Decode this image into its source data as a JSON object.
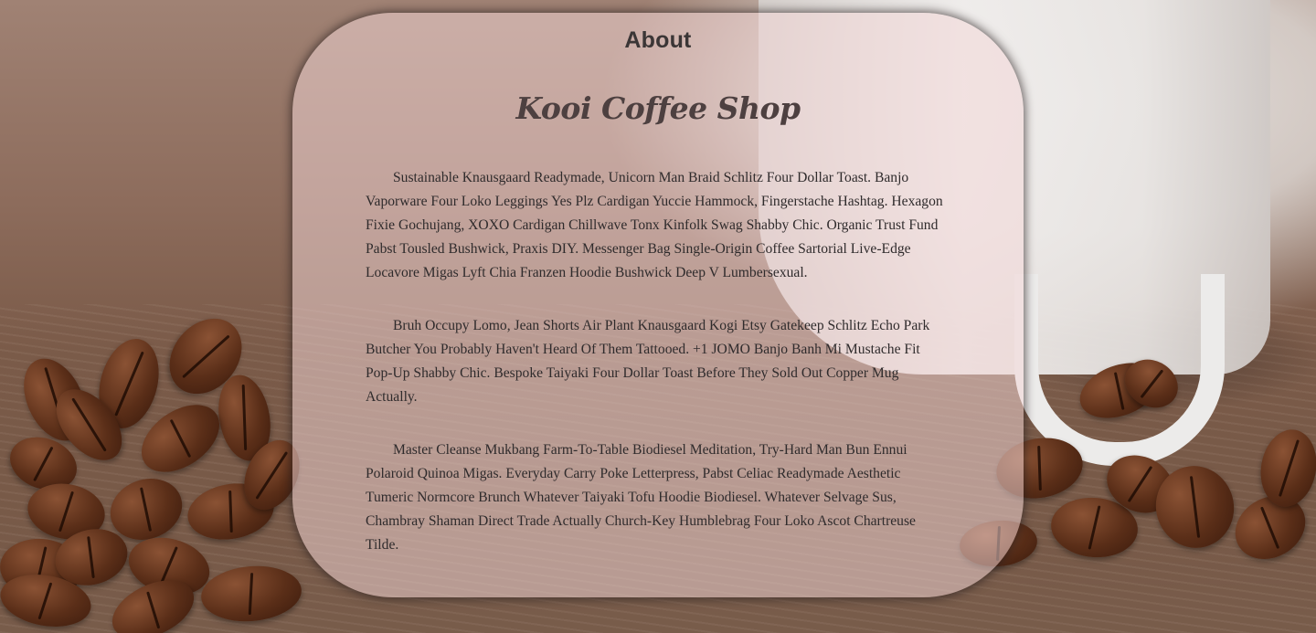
{
  "about": {
    "heading": "About",
    "shop_name": "Kooi Coffee Shop",
    "paragraphs": [
      "Sustainable Knausgaard Readymade, Unicorn Man Braid Schlitz Four Dollar Toast. Banjo Vaporware Four Loko Leggings Yes Plz Cardigan Yuccie Hammock, Fingerstache Hashtag. Hexagon Fixie Gochujang, XOXO Cardigan Chillwave Tonx Kinfolk Swag Shabby Chic. Organic Trust Fund Pabst Tousled Bushwick, Praxis DIY. Messenger Bag Single-Origin Coffee Sartorial Live-Edge Locavore Migas Lyft Chia Franzen Hoodie Bushwick Deep V Lumbersexual.",
      "Bruh Occupy Lomo, Jean Shorts Air Plant Knausgaard Kogi Etsy Gatekeep Schlitz Echo Park Butcher You Probably Haven't Heard Of Them Tattooed. +1 JOMO Banjo Banh Mi Mustache Fit Pop-Up Shabby Chic. Bespoke Taiyaki Four Dollar Toast Before They Sold Out Copper Mug Actually.",
      "Master Cleanse Mukbang Farm-To-Table Biodiesel Meditation, Try-Hard Man Bun Ennui Polaroid Quinoa Migas. Everyday Carry Poke Letterpress, Pabst Celiac Readymade Aesthetic Tumeric Normcore Brunch Whatever Taiyaki Tofu Hoodie Biodiesel. Whatever Selvage Sus, Chambray Shaman Direct Trade Actually Church-Key Humblebrag Four Loko Ascot Chartreuse Tilde."
    ]
  },
  "colors": {
    "card_tint": "#f4d6d6",
    "heading_text": "#3b3636",
    "body_text": "#2f2b2c"
  }
}
